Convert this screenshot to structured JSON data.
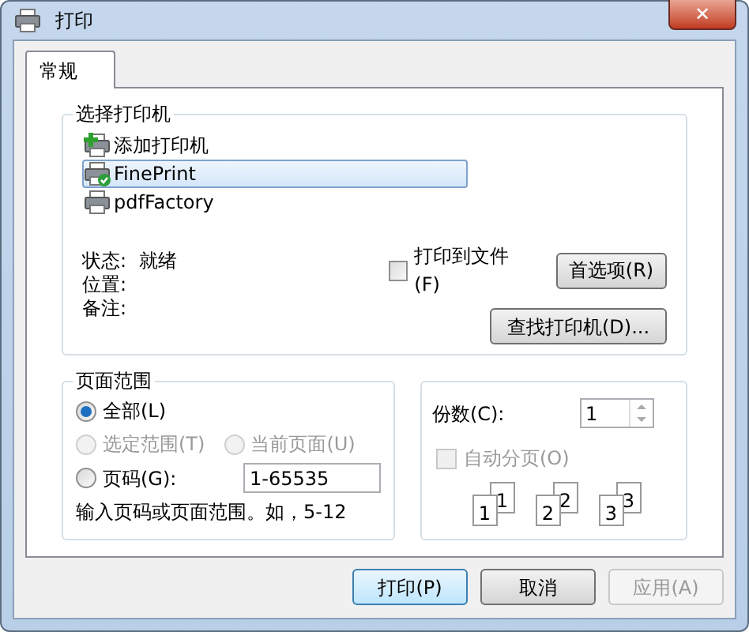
{
  "window": {
    "title": "打印",
    "close": "✕"
  },
  "tabs": [
    {
      "label": "常规",
      "selected": true
    }
  ],
  "printer_group": {
    "title": "选择打印机",
    "printers": [
      {
        "name": "添加打印机",
        "kind": "add",
        "selected": false
      },
      {
        "name": "FinePrint",
        "kind": "default",
        "selected": true
      },
      {
        "name": "pdfFactory",
        "kind": "printer",
        "selected": false
      }
    ],
    "info": [
      {
        "label": "状态:",
        "value": "就绪"
      },
      {
        "label": "位置:"
      },
      {
        "label": "备注:"
      }
    ],
    "print_to_file": {
      "label": "打印到文件(F)",
      "checked": false
    },
    "preferences_button": "首选项(R)",
    "find_button": "查找打印机(D)..."
  },
  "page_range": {
    "title": "页面范围",
    "options": [
      {
        "label": "全部(L)",
        "selected": true,
        "disabled": false
      },
      {
        "label": "选定范围(T)",
        "selected": false,
        "disabled": true
      },
      {
        "label": "当前页面(U)",
        "selected": false,
        "disabled": true
      },
      {
        "label": "页码(G):",
        "selected": false,
        "disabled": false
      }
    ],
    "pages_value": "1-65535",
    "hint": "输入页码或页面范围。如，5-12"
  },
  "copies": {
    "label": "份数(C):",
    "value": "1",
    "collate": {
      "label": "自动分页(O)",
      "checked": false,
      "disabled": true
    },
    "collate_pages": [
      {
        "front": "1",
        "back": "1"
      },
      {
        "front": "2",
        "back": "2"
      },
      {
        "front": "3",
        "back": "3"
      }
    ]
  },
  "buttons": [
    {
      "label": "打印(P)",
      "default": true,
      "disabled": false
    },
    {
      "label": "取消",
      "default": false,
      "disabled": false
    },
    {
      "label": "应用(A)",
      "default": false,
      "disabled": true
    }
  ]
}
